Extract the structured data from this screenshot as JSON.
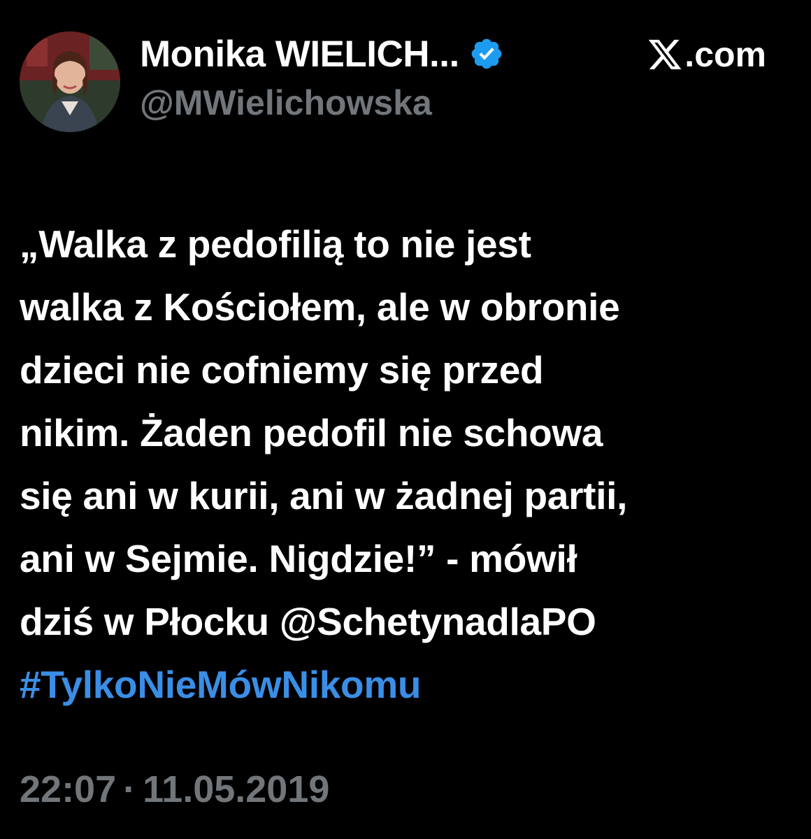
{
  "author": {
    "display_name": "Monika WIELICH...",
    "handle": "@MWielichowska",
    "verified_icon": "verified-badge-icon",
    "avatar_icon": "avatar-photo"
  },
  "source": {
    "icon": "x-logo-icon",
    "text": ".com"
  },
  "tweet": {
    "lines": [
      "„Walka z pedofilią to nie jest",
      "walka z Kościołem, ale w obronie",
      "dzieci nie cofniemy się przed",
      "nikim. Żaden pedofil nie schowa",
      "się ani w kurii, ani w żadnej partii,",
      "ani w Sejmie. Nigdzie!” - mówił",
      "dziś w Płocku "
    ],
    "mention": "@SchetynadlaPO",
    "hashtag": "#TylkoNieMówNikomu"
  },
  "meta": {
    "time": "22:07",
    "separator": "·",
    "date": "11.05.2019"
  },
  "colors": {
    "background": "#000000",
    "text": "#ffffff",
    "muted": "#71767b",
    "link": "#3a8ee6",
    "verified": "#1d9bf0"
  }
}
